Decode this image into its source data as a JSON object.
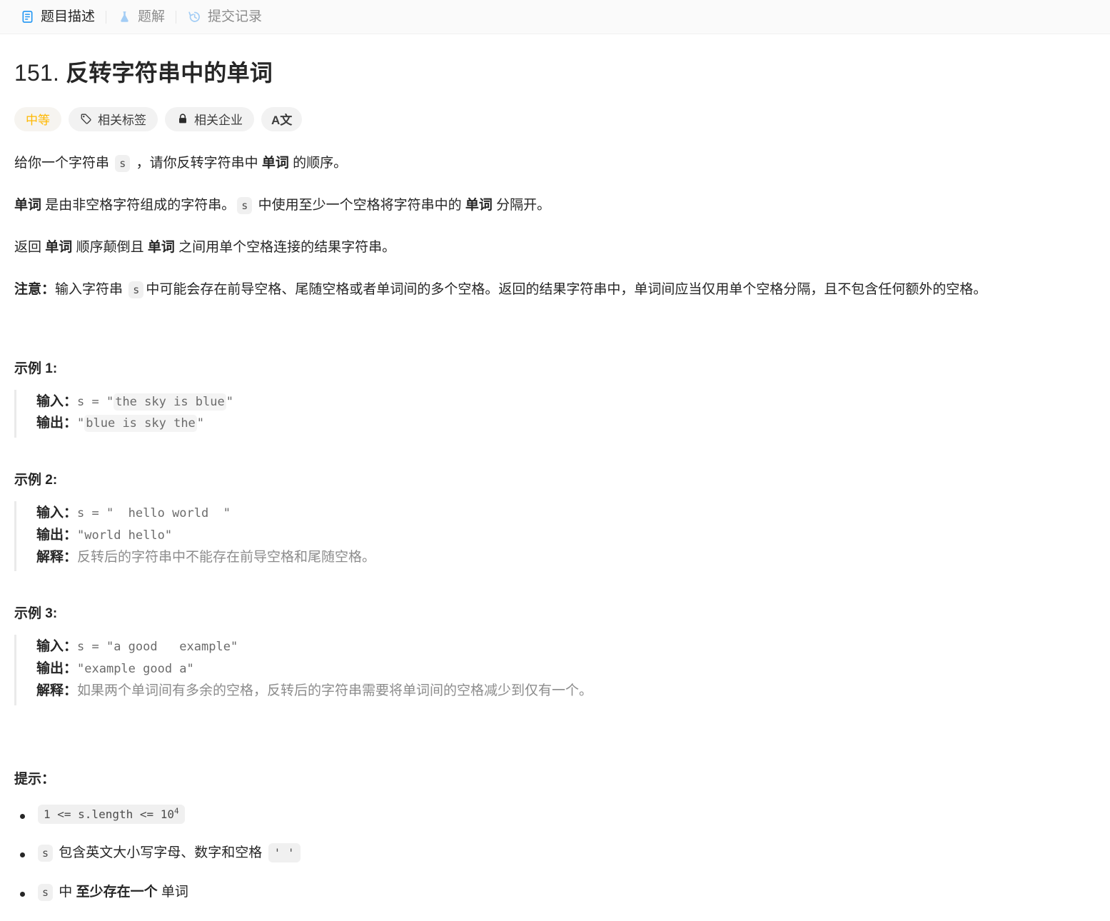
{
  "tabs": [
    {
      "id": "description",
      "label": "题目描述",
      "icon": "document-icon",
      "active": true
    },
    {
      "id": "solution",
      "label": "题解",
      "icon": "flask-icon",
      "active": false
    },
    {
      "id": "submissions",
      "label": "提交记录",
      "icon": "history-icon",
      "active": false
    }
  ],
  "problem": {
    "number": "151.",
    "name": "反转字符串中的单词",
    "full_title": "151. 反转字符串中的单词"
  },
  "pills": [
    {
      "id": "difficulty",
      "label": "中等",
      "icon": null,
      "color": "#ffb800"
    },
    {
      "id": "related-tags",
      "label": "相关标签",
      "icon": "tag-icon"
    },
    {
      "id": "related-companies",
      "label": "相关企业",
      "icon": "lock-icon"
    },
    {
      "id": "translate",
      "label": "A文",
      "icon": "translate-icon"
    }
  ],
  "description": {
    "p1": {
      "a": "给你一个字符串 ",
      "code": "s",
      "b": " ，请你反转字符串中 ",
      "strong": "单词",
      "c": " 的顺序。"
    },
    "p2": {
      "strong1": "单词",
      "a": " 是由非空格字符组成的字符串。",
      "code": "s",
      "b": " 中使用至少一个空格将字符串中的 ",
      "strong2": "单词",
      "c": " 分隔开。"
    },
    "p3": {
      "a": "返回 ",
      "strong1": "单词",
      "b": " 顺序颠倒且 ",
      "strong2": "单词",
      "c": " 之间用单个空格连接的结果字符串。"
    },
    "p4": {
      "label": "注意：",
      "a": "输入字符串 ",
      "code": "s",
      "b": "中可能会存在前导空格、尾随空格或者单词间的多个空格。返回的结果字符串中，单词间应当仅用单个空格分隔，且不包含任何额外的空格。"
    }
  },
  "examples": [
    {
      "heading": "示例 1:",
      "input_label": "输入：",
      "input_prefix": "s = \"",
      "input_value": "the sky is blue",
      "input_suffix": "\"",
      "input_highlighted": true,
      "output_label": "输出：",
      "output_prefix": "\"",
      "output_value": "blue is sky the",
      "output_suffix": "\"",
      "output_highlighted": true,
      "explanation_label": null,
      "explanation": null
    },
    {
      "heading": "示例 2:",
      "input_label": "输入：",
      "input_prefix": "",
      "input_value": "s = \"  hello world  \"",
      "input_suffix": "",
      "input_highlighted": false,
      "output_label": "输出：",
      "output_prefix": "",
      "output_value": "\"world hello\"",
      "output_suffix": "",
      "output_highlighted": false,
      "explanation_label": "解释：",
      "explanation": "反转后的字符串中不能存在前导空格和尾随空格。"
    },
    {
      "heading": "示例 3:",
      "input_label": "输入：",
      "input_prefix": "",
      "input_value": "s = \"a good   example\"",
      "input_suffix": "",
      "input_highlighted": false,
      "output_label": "输出：",
      "output_prefix": "",
      "output_value": "\"example good a\"",
      "output_suffix": "",
      "output_highlighted": false,
      "explanation_label": "解释：",
      "explanation": "如果两个单词间有多余的空格，反转后的字符串需要将单词间的空格减少到仅有一个。"
    }
  ],
  "hints": {
    "title": "提示：",
    "items": [
      {
        "kind": "code-pow",
        "code_prefix": "1 <= s.length <= 10",
        "code_sup": "4"
      },
      {
        "kind": "code-text-code",
        "code1": "s",
        "text": " 包含英文大小写字母、数字和空格 ",
        "code2": "' '"
      },
      {
        "kind": "code-text-strong",
        "code1": "s",
        "text1": " 中 ",
        "strong": "至少存在一个",
        "text2": " 单词"
      }
    ]
  },
  "colors": {
    "accent_blue": "#2196f3",
    "icon_blue_light": "#a3cdf5",
    "difficulty_yellow": "#ffb800",
    "chip_bg": "#f0f0f0",
    "tabbar_bg": "#fafafa",
    "border": "#f0f0f0",
    "muted_text": "#8c8c8c"
  }
}
